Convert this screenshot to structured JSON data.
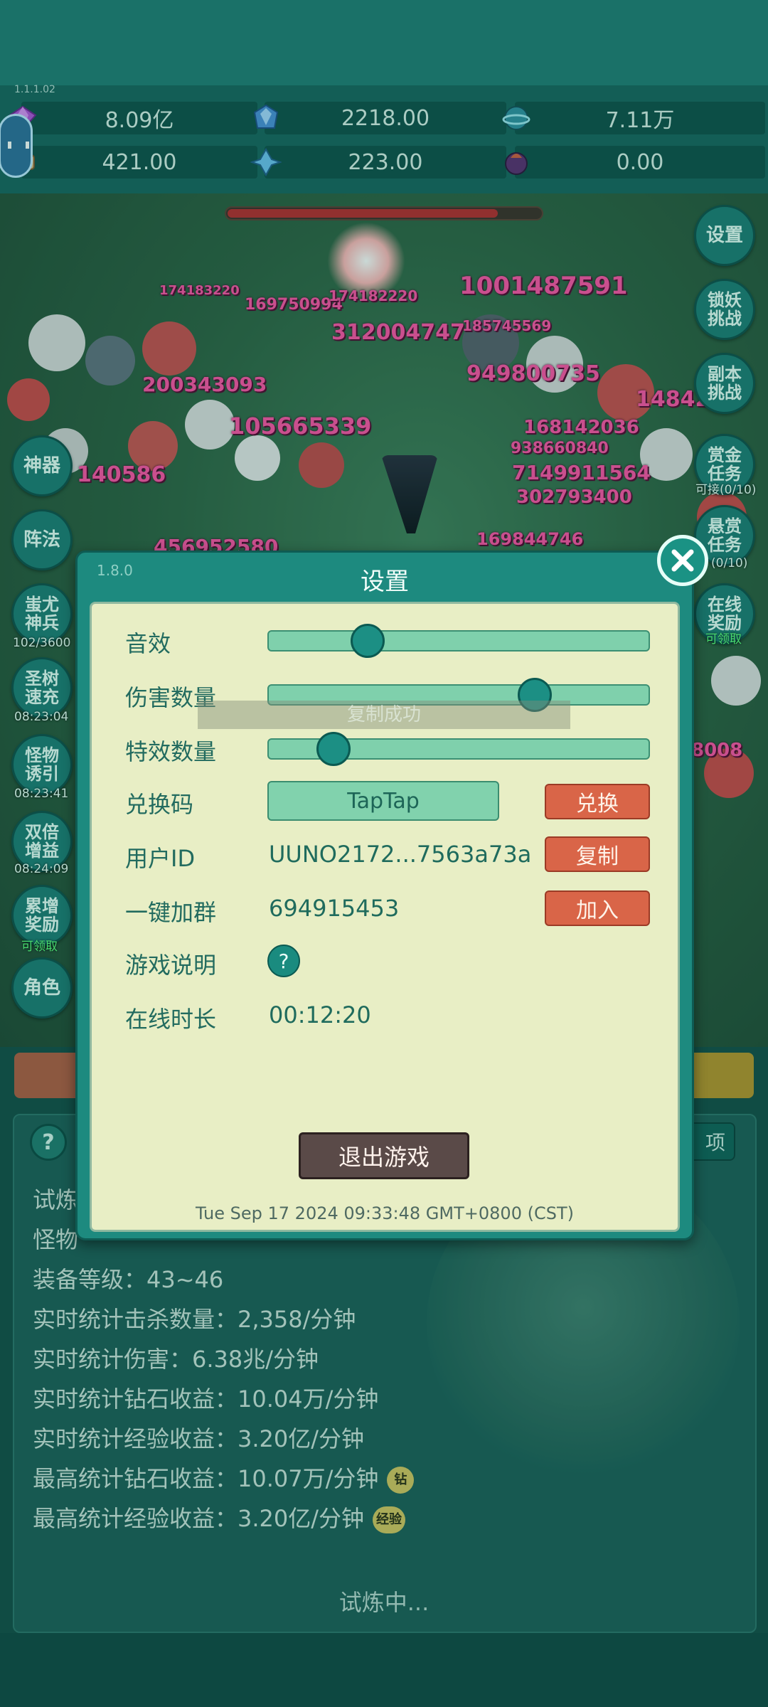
{
  "top": {
    "version_small": "1.1.1.02"
  },
  "resources": [
    {
      "icon": "purple-gem-icon",
      "value": "8.09亿"
    },
    {
      "icon": "blue-crystal-icon",
      "value": "2218.00"
    },
    {
      "icon": "planet-orb-icon",
      "value": "7.11万"
    },
    {
      "icon": "scroll-icon",
      "value": "421.00"
    },
    {
      "icon": "ice-shard-icon",
      "value": "223.00"
    },
    {
      "icon": "dark-orb-icon",
      "value": "0.00"
    }
  ],
  "game": {
    "damage_numbers": [
      "1001487591",
      "312004747",
      "105665339",
      "200343093",
      "169750994",
      "949800735",
      "7149911564",
      "302793400",
      "140586",
      "168142036",
      "938660840",
      "169844746",
      "456952580",
      "14842",
      "8008",
      "174182220",
      "185745569",
      "174183220"
    ]
  },
  "side_buttons": {
    "settings": "设置",
    "lock_demon": "锁妖挑战",
    "dungeon": "副本挑战",
    "gold_task": "赏金任务",
    "gold_task_sub": "可接(0/10)",
    "bounty_task": "悬赏任务",
    "bounty_task_sub": "(0/10)",
    "online_reward": "在线奖励",
    "online_reward_sub": "可领取",
    "artifact": "神器",
    "formation": "阵法",
    "chiyou": "蚩尤神兵",
    "chiyou_sub": "102/3600",
    "tree": "圣树速充",
    "tree_sub": "08:23:04",
    "lure": "怪物诱引",
    "lure_sub": "08:23:41",
    "double": "双倍增益",
    "double_sub": "08:24:09",
    "accumulate": "累增奖励",
    "accumulate_sub": "可领取",
    "role": "角色"
  },
  "stats": {
    "help": "?",
    "right_btn": "项",
    "lines": [
      "试炼",
      "怪物",
      "装备等级：43~46",
      "实时统计击杀数量：2,358/分钟",
      "实时统计伤害：6.38兆/分钟",
      "实时统计钻石收益：10.04万/分钟",
      "实时统计经验收益：3.20亿/分钟",
      "最高统计钻石收益：10.07万/分钟",
      "最高统计经验收益：3.20亿/分钟"
    ],
    "badge_diamond": "钻",
    "badge_exp": "经验",
    "status": "试炼中..."
  },
  "toast": "复制成功",
  "dialog": {
    "version": "1.8.0",
    "title": "设置",
    "sound_label": "音效",
    "damage_count_label": "伤害数量",
    "effects_label": "特效数量",
    "sound_level": 0.26,
    "damage_count_level": 0.7,
    "effects_level": 0.17,
    "redeem_label": "兑换码",
    "redeem_value": "TapTap",
    "redeem_button": "兑换",
    "userid_label": "用户ID",
    "userid_value": "UUNO2172...7563a73a",
    "copy_button": "复制",
    "group_label": "一键加群",
    "group_value": "694915453",
    "join_button": "加入",
    "guide_label": "游戏说明",
    "guide_button": "?",
    "online_label": "在线时长",
    "online_value": "00:12:20",
    "exit_button": "退出游戏",
    "clock": "Tue Sep 17 2024 09:33:48 GMT+0800 (CST)"
  }
}
